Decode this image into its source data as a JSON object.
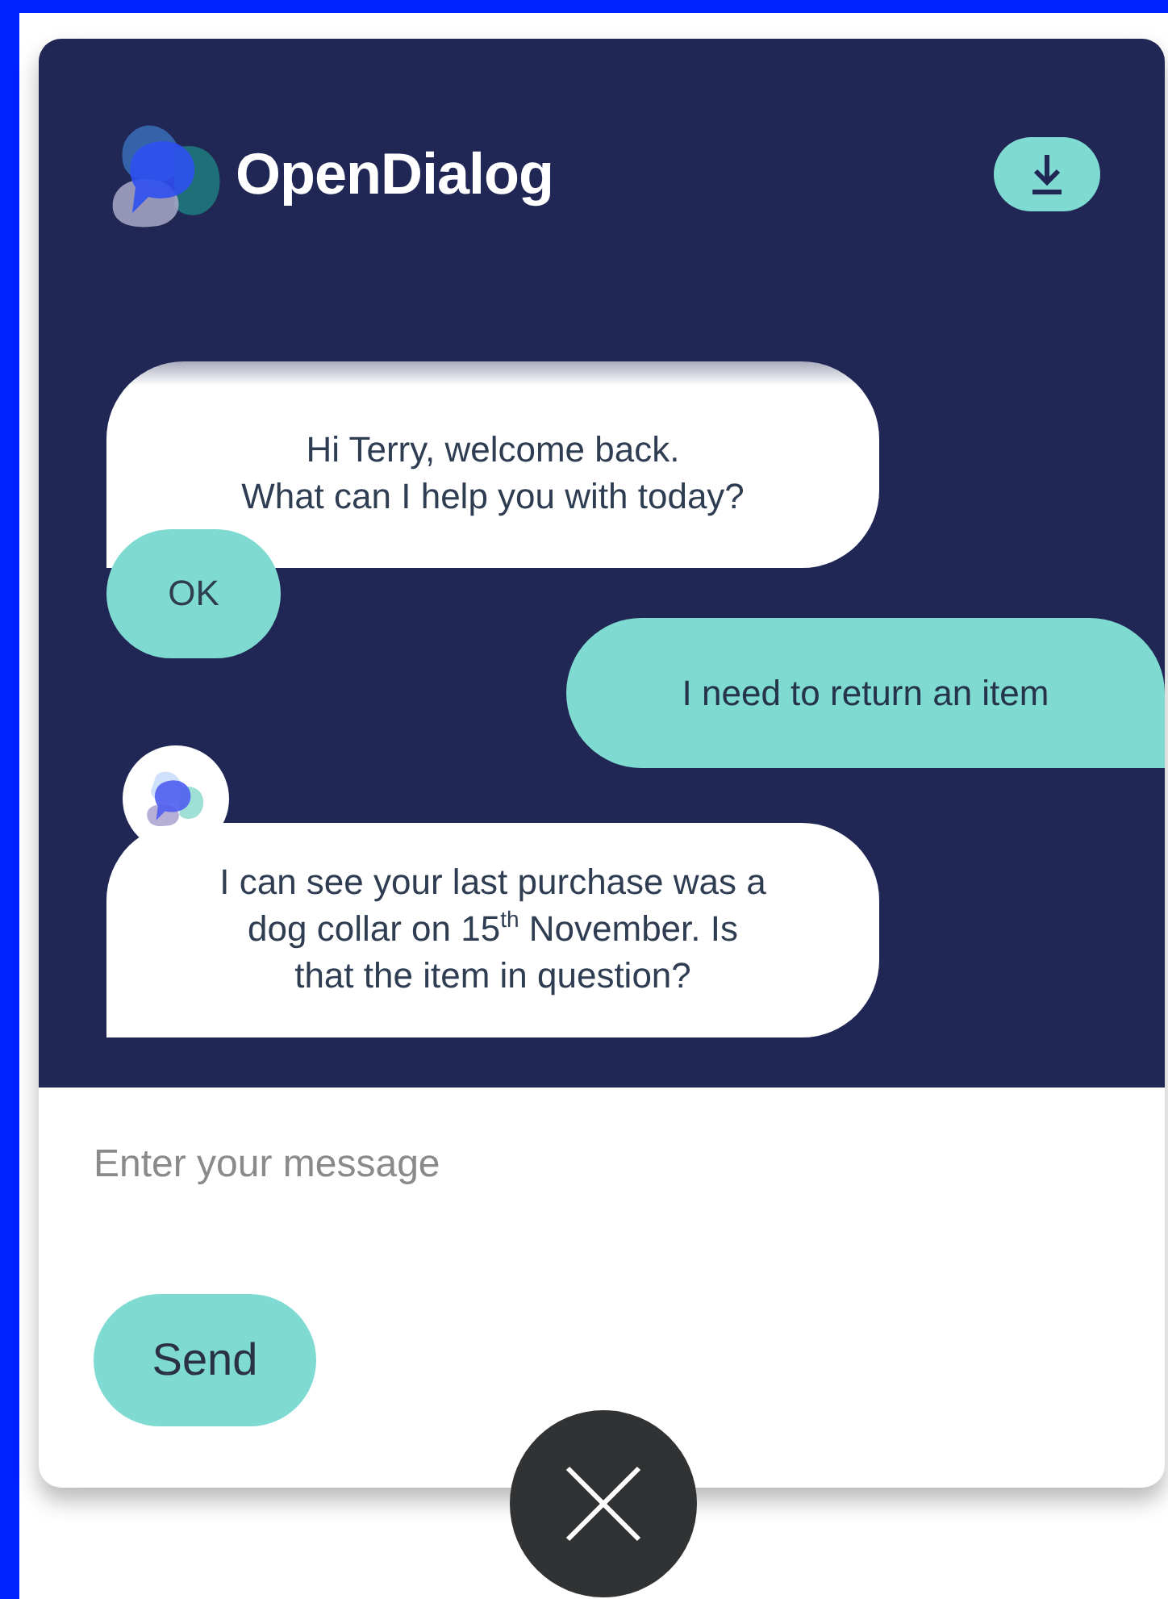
{
  "header": {
    "title": "OpenDialog"
  },
  "messages": [
    {
      "kind": "bot",
      "avatar": false,
      "text": "Hi Terry, welcome back.\nWhat can I help you with today?"
    },
    {
      "kind": "button",
      "text": "OK"
    },
    {
      "kind": "user",
      "text": "I need to return an item"
    },
    {
      "kind": "bot",
      "avatar": true,
      "text": "I can see your last purchase was a\ndog collar on 15$^{th}$ November. Is\nthat the item in question?"
    }
  ],
  "composer": {
    "placeholder": "Enter your message",
    "send": "Send"
  }
}
